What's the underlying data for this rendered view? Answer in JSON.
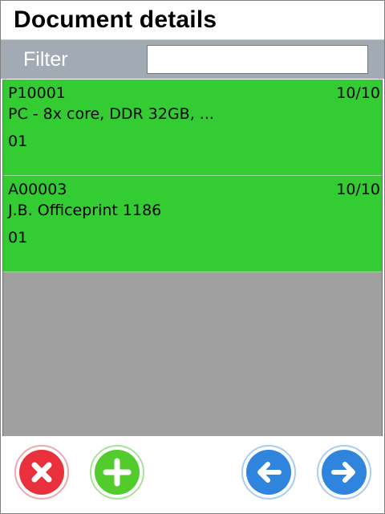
{
  "header": {
    "title": "Document details"
  },
  "filter": {
    "label": "Filter",
    "value": "",
    "placeholder": ""
  },
  "items": [
    {
      "code": "P10001",
      "quantity": "10/10",
      "description": "PC - 8x core, DDR 32GB, ...",
      "location": "01"
    },
    {
      "code": "A00003",
      "quantity": "10/10",
      "description": "J.B. Officeprint 1186",
      "location": "01"
    }
  ],
  "colors": {
    "item_background": "#33cc33",
    "list_background": "#a0a0a0",
    "filter_bar": "#a2abb4",
    "cancel": "#e8313c",
    "add": "#52cc2d",
    "navigate": "#2f85de"
  },
  "icons": {
    "cancel": "close-circle-icon",
    "add": "plus-circle-icon",
    "back": "arrow-left-circle-icon",
    "forward": "arrow-right-circle-icon"
  }
}
